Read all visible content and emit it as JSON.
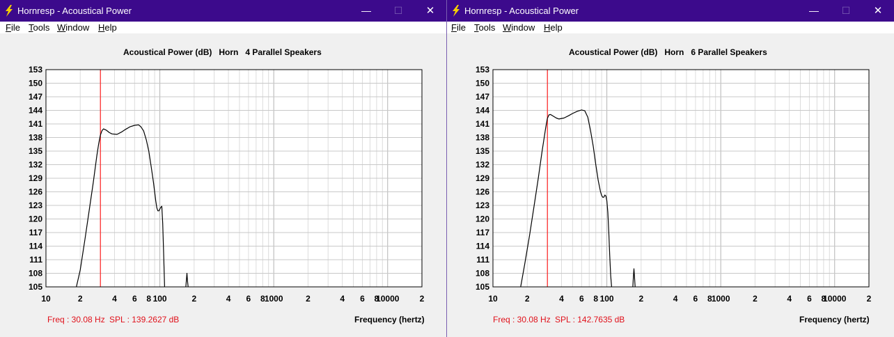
{
  "windows": [
    {
      "title": "Hornresp - Acoustical Power",
      "menu": [
        "File",
        "Tools",
        "Window",
        "Help"
      ],
      "controls": {
        "minimize": "—",
        "maximize": "☐",
        "close": "✕"
      },
      "chart_title": "Acoustical Power (dB)   Horn   4 Parallel Speakers",
      "readout_freq": "Freq : 30.08 Hz",
      "readout_spl": "SPL : 139.2627 dB",
      "x_axis_label": "Frequency (hertz)"
    },
    {
      "title": "Hornresp - Acoustical Power",
      "menu": [
        "File",
        "Tools",
        "Window",
        "Help"
      ],
      "controls": {
        "minimize": "—",
        "maximize": "☐",
        "close": "✕"
      },
      "chart_title": "Acoustical Power (dB)   Horn   6 Parallel Speakers",
      "readout_freq": "Freq : 30.08 Hz",
      "readout_spl": "SPL : 142.7635 dB",
      "x_axis_label": "Frequency (hertz)"
    }
  ],
  "chart_data": [
    {
      "type": "line",
      "title": "Acoustical Power (dB)   Horn   4 Parallel Speakers",
      "xlabel": "Frequency (hertz)",
      "ylabel": "",
      "xscale": "log",
      "xlim": [
        10,
        20000
      ],
      "ylim": [
        105,
        153
      ],
      "yticks": [
        105,
        108,
        111,
        114,
        117,
        120,
        123,
        126,
        129,
        132,
        135,
        138,
        141,
        144,
        147,
        150,
        153
      ],
      "xtick_labels": [
        {
          "value": 10,
          "label": "10"
        },
        {
          "value": 20,
          "label": "2"
        },
        {
          "value": 40,
          "label": "4"
        },
        {
          "value": 60,
          "label": "6"
        },
        {
          "value": 80,
          "label": "8"
        },
        {
          "value": 100,
          "label": "100"
        },
        {
          "value": 200,
          "label": "2"
        },
        {
          "value": 400,
          "label": "4"
        },
        {
          "value": 600,
          "label": "6"
        },
        {
          "value": 800,
          "label": "8"
        },
        {
          "value": 1000,
          "label": "1000"
        },
        {
          "value": 2000,
          "label": "2"
        },
        {
          "value": 4000,
          "label": "4"
        },
        {
          "value": 6000,
          "label": "6"
        },
        {
          "value": 8000,
          "label": "8"
        },
        {
          "value": 10000,
          "label": "10000"
        },
        {
          "value": 20000,
          "label": "2"
        }
      ],
      "grid": true,
      "cursor_x": 30.08,
      "cursor_color": "#ff2020",
      "line_color": "#000000",
      "series": [
        {
          "x": [
            18.5,
            20,
            22,
            24,
            26,
            28,
            29,
            30,
            31,
            32,
            34,
            36,
            38,
            42,
            46,
            50,
            55,
            60,
            65,
            68,
            72,
            76,
            80,
            84,
            88,
            90,
            92,
            94,
            96,
            98,
            100,
            102,
            104,
            106,
            108,
            110
          ],
          "y": [
            105,
            108.7,
            115.5,
            122,
            128,
            134,
            136.5,
            138.5,
            139.5,
            139.9,
            139.6,
            139.1,
            138.8,
            138.7,
            139.2,
            139.8,
            140.4,
            140.7,
            140.8,
            140.4,
            139.5,
            137.5,
            135,
            131.5,
            128,
            126,
            124,
            122.5,
            121.8,
            121.8,
            122.2,
            122.6,
            122.8,
            119,
            112,
            105
          ]
        },
        {
          "x": [
            169,
            171,
            173,
            175,
            177
          ],
          "y": [
            105,
            106.5,
            108,
            106.3,
            105
          ]
        }
      ]
    },
    {
      "type": "line",
      "title": "Acoustical Power (dB)   Horn   6 Parallel Speakers",
      "xlabel": "Frequency (hertz)",
      "ylabel": "",
      "xscale": "log",
      "xlim": [
        10,
        20000
      ],
      "ylim": [
        105,
        153
      ],
      "yticks": [
        105,
        108,
        111,
        114,
        117,
        120,
        123,
        126,
        129,
        132,
        135,
        138,
        141,
        144,
        147,
        150,
        153
      ],
      "xtick_labels": [
        {
          "value": 10,
          "label": "10"
        },
        {
          "value": 20,
          "label": "2"
        },
        {
          "value": 40,
          "label": "4"
        },
        {
          "value": 60,
          "label": "6"
        },
        {
          "value": 80,
          "label": "8"
        },
        {
          "value": 100,
          "label": "100"
        },
        {
          "value": 200,
          "label": "2"
        },
        {
          "value": 400,
          "label": "4"
        },
        {
          "value": 600,
          "label": "6"
        },
        {
          "value": 800,
          "label": "8"
        },
        {
          "value": 1000,
          "label": "1000"
        },
        {
          "value": 2000,
          "label": "2"
        },
        {
          "value": 4000,
          "label": "4"
        },
        {
          "value": 6000,
          "label": "6"
        },
        {
          "value": 8000,
          "label": "8"
        },
        {
          "value": 10000,
          "label": "10000"
        },
        {
          "value": 20000,
          "label": "2"
        }
      ],
      "grid": true,
      "cursor_x": 30.08,
      "cursor_color": "#ff2020",
      "line_color": "#000000",
      "series": [
        {
          "x": [
            17.5,
            19,
            21,
            23,
            25,
            27,
            28,
            29,
            30,
            31,
            32,
            34,
            36,
            38,
            42,
            46,
            50,
            55,
            60,
            64,
            68,
            72,
            76,
            80,
            84,
            88,
            90,
            92,
            94,
            96,
            98,
            100,
            102,
            104,
            106,
            108,
            110
          ],
          "y": [
            105,
            110,
            116.5,
            123,
            129,
            135,
            137.5,
            140,
            142.2,
            143,
            143.1,
            142.7,
            142.3,
            142.1,
            142.3,
            142.8,
            143.3,
            143.8,
            144.1,
            143.9,
            142.5,
            139.5,
            136,
            132,
            128.5,
            126,
            125.2,
            124.8,
            124.8,
            125.3,
            125.1,
            124,
            121.5,
            117,
            112,
            107.5,
            105
          ]
        },
        {
          "x": [
            169,
            171,
            173,
            175,
            177
          ],
          "y": [
            105,
            107.2,
            109,
            107.2,
            105
          ]
        }
      ]
    }
  ]
}
